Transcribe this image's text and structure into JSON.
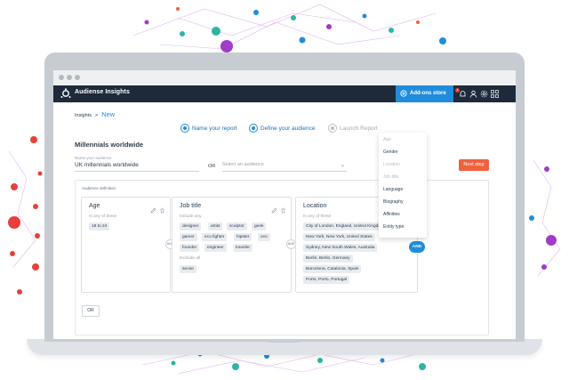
{
  "app": {
    "title": "Audiense Insights",
    "addons_label": "Add-ons store",
    "notification_count": "1"
  },
  "breadcrumb": {
    "root": "Insights",
    "separator": ">",
    "current": "New"
  },
  "steps": [
    {
      "label": "Name your report",
      "state": "done"
    },
    {
      "label": "Define your audience",
      "state": "active"
    },
    {
      "label": "Launch Report",
      "state": "inactive"
    }
  ],
  "report": {
    "title": "Millennials worldwide",
    "audience_label": "Name your audience",
    "audience_value": "UK millennials worldwide",
    "or_label": "OR",
    "select_placeholder": "Select an audience",
    "next_label": "Next step"
  },
  "definition": {
    "label": "Audience definition",
    "cards": [
      {
        "title": "Age",
        "subtitle": "Is any of these",
        "chips": [
          "18 to 24"
        ]
      },
      {
        "title": "Job title",
        "subtitle": "Include any",
        "chips": [
          "designer",
          "artist",
          "sculptor",
          "geek",
          "gamer",
          "eco fighter",
          "hipster",
          "ceo",
          "founder",
          "engineer",
          "traveler"
        ],
        "exclude_label": "Exclude all",
        "exclude_chips": [
          "senior"
        ]
      },
      {
        "title": "Location",
        "subtitle": "Is any of these",
        "items": [
          "City of London, England, United Kingdom",
          "New York, New York, United States",
          "Sydney, New South Wales, Australia",
          "Berlin, Berlin, Germany",
          "Barcelona, Catalonia, Spain",
          "Porto, Porto, Portugal"
        ]
      }
    ],
    "connector_label": "AND",
    "and_button": "AND",
    "or_button": "OR"
  },
  "dropdown": {
    "items": [
      {
        "label": "Age",
        "enabled": false
      },
      {
        "label": "Gender",
        "enabled": true
      },
      {
        "label": "Location",
        "enabled": false
      },
      {
        "label": "Job title",
        "enabled": false
      },
      {
        "label": "Language",
        "enabled": true
      },
      {
        "label": "Biography",
        "enabled": true
      },
      {
        "label": "Affinities",
        "enabled": true
      },
      {
        "label": "Entity type",
        "enabled": true
      }
    ]
  },
  "colors": {
    "nav": "#1e2a3a",
    "accent": "#1f8ddb",
    "cta": "#f0613c"
  }
}
